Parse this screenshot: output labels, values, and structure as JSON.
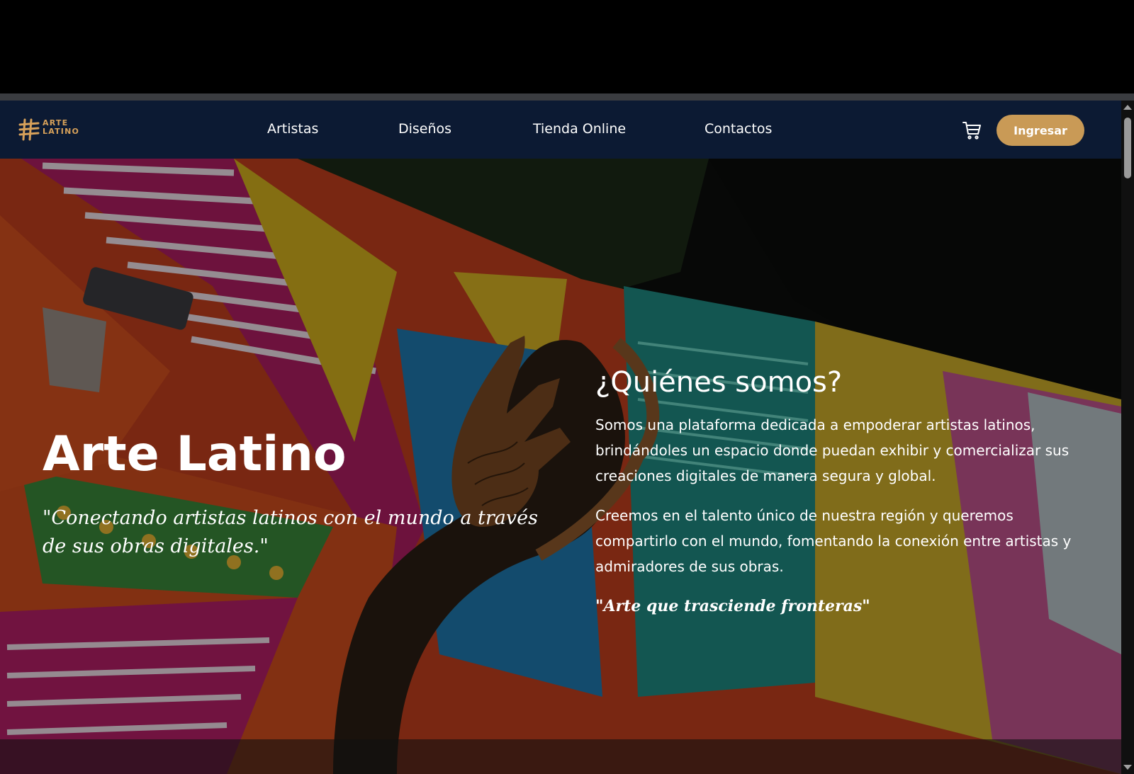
{
  "brand": {
    "line1": "ARTE",
    "line2": "LATINO",
    "color": "#d7a15a"
  },
  "nav": {
    "items": [
      {
        "label": "Artistas"
      },
      {
        "label": "Diseños"
      },
      {
        "label": "Tienda Online"
      },
      {
        "label": "Contactos"
      }
    ],
    "cart_icon": "shopping-cart-icon",
    "login_label": "Ingresar",
    "background": "#0c1a33",
    "accent": "#c99a56"
  },
  "hero": {
    "title": "Arte Latino",
    "quote": "\"Conectando artistas latinos con el mundo a través de sus obras digitales.\""
  },
  "about": {
    "heading": "¿Quiénes somos?",
    "paragraph1": "Somos una plataforma dedicada a empoderar artistas latinos, brindándoles un espacio donde puedan exhibir y comercializar sus creaciones digitales de manera segura y global.",
    "paragraph2": "Creemos en el talento único de nuestra región y queremos compartirlo con el mundo, fomentando la conexión entre artistas y admiradores de sus obras.",
    "motto": "\"Arte que trasciende fronteras\""
  }
}
